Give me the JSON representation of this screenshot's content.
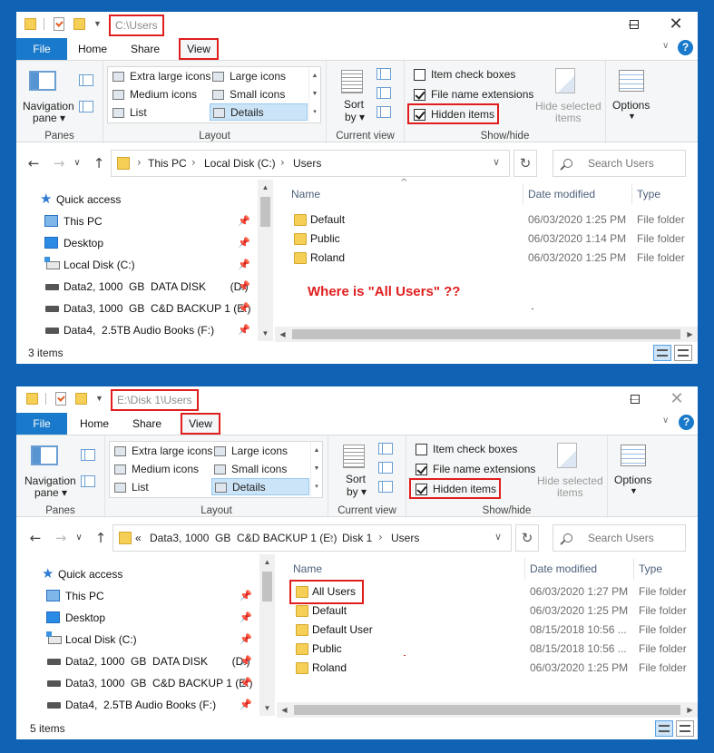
{
  "windows": [
    {
      "title_path": "C:\\Users",
      "tabs": {
        "file": "File",
        "home": "Home",
        "share": "Share",
        "view": "View"
      },
      "ribbon": {
        "panes": {
          "navigation_pane": "Navigation",
          "navigation_pane2": "pane",
          "group": "Panes"
        },
        "layout": {
          "items": [
            "Extra large icons",
            "Large icons",
            "Medium icons",
            "Small icons",
            "List",
            "Details"
          ],
          "selected": "Details",
          "group": "Layout"
        },
        "current_view": {
          "sort_by": "Sort",
          "sort_by2": "by",
          "group": "Current view"
        },
        "show_hide": {
          "item_check_boxes": "Item check boxes",
          "file_name_extensions": "File name extensions",
          "hidden_items": "Hidden items",
          "hide_selected": "Hide selected",
          "hide_selected2": "items",
          "group": "Show/hide",
          "checks": {
            "item_check_boxes": false,
            "file_name_extensions": true,
            "hidden_items": true
          }
        },
        "options": "Options"
      },
      "address": {
        "crumbs": [
          "This PC",
          "Local Disk (C:)",
          "Users"
        ]
      },
      "search_placeholder": "Search Users",
      "nav": [
        "Quick access",
        "This PC",
        "Desktop",
        "Local Disk (C:)",
        "Data2, 1000  GB  DATA DISK        (D:)",
        "Data3, 1000  GB  C&D BACKUP 1 (E:)",
        "Data4,  2.5TB Audio Books (F:)"
      ],
      "columns": {
        "name": "Name",
        "date": "Date modified",
        "type": "Type"
      },
      "files": [
        {
          "name": "Default",
          "date": "06/03/2020 1:25 PM",
          "type": "File folder"
        },
        {
          "name": "Public",
          "date": "06/03/2020 1:14 PM",
          "type": "File folder"
        },
        {
          "name": "Roland",
          "date": "06/03/2020 1:25 PM",
          "type": "File folder"
        }
      ],
      "annotation": "Where is \"All Users\" ??",
      "status": "3 items"
    },
    {
      "title_path": "E:\\Disk 1\\Users",
      "tabs": {
        "file": "File",
        "home": "Home",
        "share": "Share",
        "view": "View"
      },
      "ribbon": {
        "panes": {
          "navigation_pane": "Navigation",
          "navigation_pane2": "pane",
          "group": "Panes"
        },
        "layout": {
          "items": [
            "Extra large icons",
            "Large icons",
            "Medium icons",
            "Small icons",
            "List",
            "Details"
          ],
          "selected": "Details",
          "group": "Layout"
        },
        "current_view": {
          "sort_by": "Sort",
          "sort_by2": "by",
          "group": "Current view"
        },
        "show_hide": {
          "item_check_boxes": "Item check boxes",
          "file_name_extensions": "File name extensions",
          "hidden_items": "Hidden items",
          "hide_selected": "Hide selected",
          "hide_selected2": "items",
          "group": "Show/hide",
          "checks": {
            "item_check_boxes": false,
            "file_name_extensions": true,
            "hidden_items": true
          }
        },
        "options": "Options"
      },
      "address": {
        "overflow": "«",
        "crumbs": [
          "Data3, 1000  GB  C&D BACKUP 1 (E:)",
          "Disk 1",
          "Users"
        ]
      },
      "search_placeholder": "Search Users",
      "nav": [
        "Quick access",
        "This PC",
        "Desktop",
        "Local Disk (C:)",
        "Data2, 1000  GB  DATA DISK        (D:)",
        "Data3, 1000  GB  C&D BACKUP 1 (E:)",
        "Data4,  2.5TB Audio Books (F:)"
      ],
      "columns": {
        "name": "Name",
        "date": "Date modified",
        "type": "Type"
      },
      "files": [
        {
          "name": "All Users",
          "date": "06/03/2020 1:27 PM",
          "type": "File folder"
        },
        {
          "name": "Default",
          "date": "06/03/2020 1:25 PM",
          "type": "File folder"
        },
        {
          "name": "Default User",
          "date": "08/15/2018 10:56 ...",
          "type": "File folder"
        },
        {
          "name": "Public",
          "date": "08/15/2018 10:56 ...",
          "type": "File folder"
        },
        {
          "name": "Roland",
          "date": "06/03/2020 1:25 PM",
          "type": "File folder"
        }
      ],
      "status": "5 items"
    }
  ],
  "colors": {
    "highlight_red": "#e01e1e",
    "accent_blue": "#1979ca",
    "desktop_blue": "#0f62b4"
  }
}
